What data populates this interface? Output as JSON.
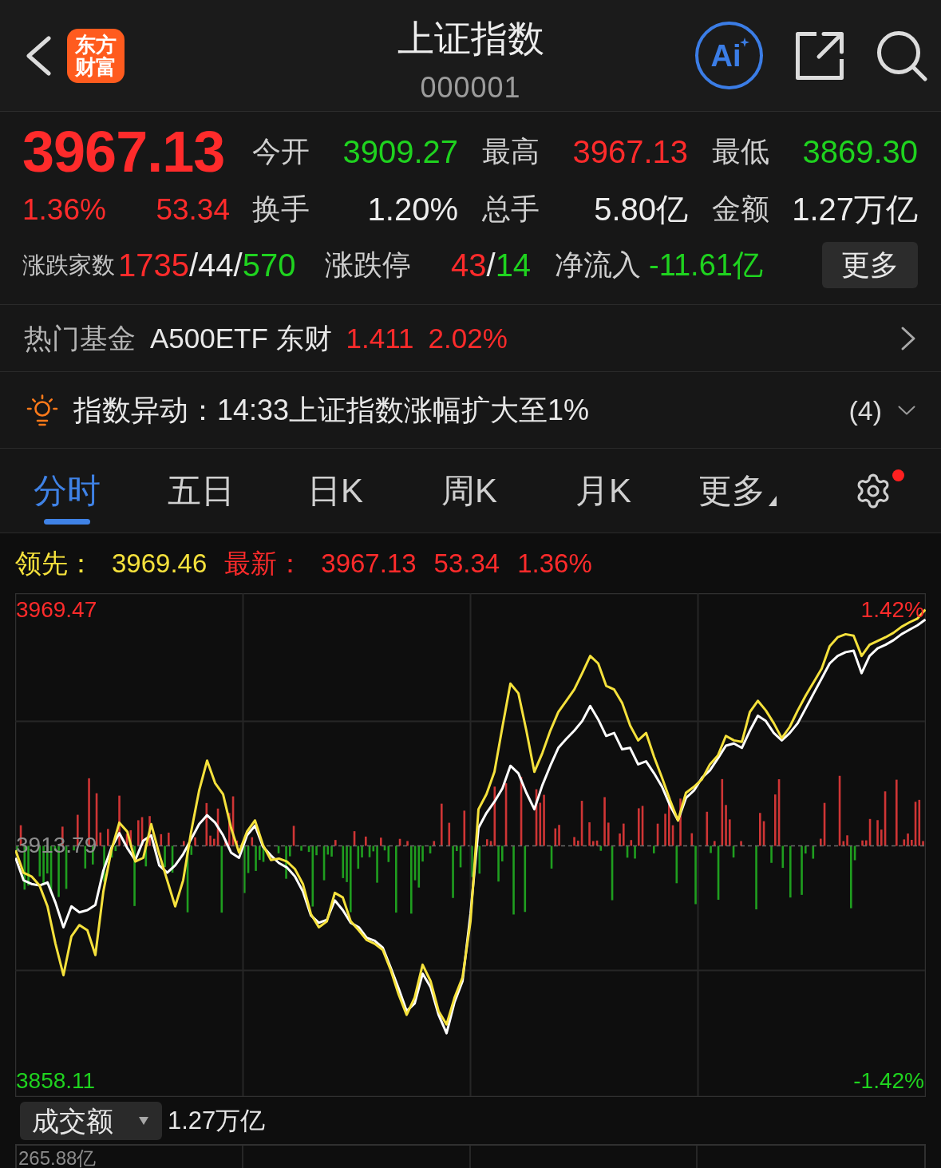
{
  "header": {
    "logo_lines": [
      "东方",
      "财富"
    ],
    "title": "上证指数",
    "code": "000001",
    "ai_label": "Ai"
  },
  "quote": {
    "price": "3967.13",
    "change_pct": "1.36%",
    "change": "53.34",
    "color": "#ff2b2b",
    "stat_rows": [
      [
        {
          "label": "今开",
          "value": "3909.27",
          "color": "#1fd31f"
        },
        {
          "label": "最高",
          "value": "3967.13",
          "color": "#ff2b2b"
        },
        {
          "label": "最低",
          "value": "3869.30",
          "color": "#1fd31f"
        }
      ],
      [
        {
          "label": "换手",
          "value": "1.20%",
          "color": "#ececec"
        },
        {
          "label": "总手",
          "value": "5.80亿",
          "color": "#ececec"
        },
        {
          "label": "金额",
          "value": "1.27万亿",
          "color": "#ececec"
        }
      ]
    ],
    "breadth": {
      "label": "涨跌家数",
      "parts": [
        {
          "text": "1735",
          "color": "#ff2b2b"
        },
        {
          "text": "/44/",
          "color": "#ececec"
        },
        {
          "text": "570",
          "color": "#1fd31f"
        }
      ]
    },
    "limits": {
      "label": "涨跌停",
      "parts": [
        {
          "text": "43",
          "color": "#ff2b2b"
        },
        {
          "text": "/",
          "color": "#ececec"
        },
        {
          "text": "14",
          "color": "#1fd31f"
        }
      ]
    },
    "net_inflow": {
      "label": "净流入",
      "value": "-11.61亿",
      "color": "#1fd31f"
    },
    "more_button": "更多"
  },
  "hot_fund": {
    "label": "热门基金",
    "name": "A500ETF 东财",
    "price": "1.411",
    "change_pct": "2.02%",
    "color": "#ff2b2b"
  },
  "alert": {
    "text": "指数异动：14:33上证指数涨幅扩大至1%",
    "count": "(4)"
  },
  "tabs": [
    {
      "label": "分时",
      "selected": true,
      "kind": "tab"
    },
    {
      "label": "五日",
      "selected": false,
      "kind": "tab"
    },
    {
      "label": "日K",
      "selected": false,
      "kind": "tab"
    },
    {
      "label": "周K",
      "selected": false,
      "kind": "tab"
    },
    {
      "label": "月K",
      "selected": false,
      "kind": "tab"
    },
    {
      "label": "更多",
      "selected": false,
      "kind": "menu"
    }
  ],
  "settings": {
    "notification": true
  },
  "chart_header": {
    "leading": {
      "label": "领先：",
      "value": "3969.46"
    },
    "latest": {
      "label": "最新：",
      "price": "3967.13",
      "change": "53.34",
      "change_pct": "1.36%",
      "color": "#ff2b2b"
    }
  },
  "chart": {
    "chart_data": {
      "type": "line",
      "ylim": [
        3854.34,
        3973.25
      ],
      "yticks": [
        {
          "value": 3969.47,
          "label": "3969.47"
        },
        {
          "value": 3913.79,
          "label": "3913.79"
        },
        {
          "value": 3858.11,
          "label": "3858.11"
        }
      ],
      "series": [
        {
          "color": "#ffffff",
          "values": [
            3910.78,
            3905.48,
            3904.6,
            3904.24,
            3904.95,
            3900.18,
            3894.35,
            3899.3,
            3897.88,
            3898.41,
            3899.65,
            3907.78,
            3913.08,
            3916.62,
            3913.08,
            3910.25,
            3914.85,
            3916.09,
            3909.02,
            3907.25,
            3909.02,
            3911.67,
            3915.2,
            3918.74,
            3920.86,
            3919.09,
            3916.09,
            3912.02,
            3910.78,
            3916.09,
            3918.39,
            3913.44,
            3911.32,
            3909.55,
            3908.49,
            3906.37,
            3902.83,
            3897.17,
            3895.41,
            3896.11,
            3900.71,
            3898.41,
            3895.41,
            3894.35,
            3891.87,
            3891.16,
            3889.57,
            3884.8,
            3879.85,
            3874.55,
            3876.32,
            3883.39,
            3880.21,
            3873.67,
            3869.3,
            3876.67,
            3881.62,
            3897.53,
            3917.86,
            3921.39,
            3924.04,
            3927.22,
            3932.53,
            3930.76,
            3926.16,
            3922.27,
            3927.93,
            3932.53,
            3936.77,
            3938.89,
            3940.83,
            3943.13,
            3946.67,
            3943.49,
            3939.6,
            3940.3,
            3936.42,
            3936.77,
            3932.88,
            3933.59,
            3930.76,
            3927.58,
            3923.16,
            3919.62,
            3924.93,
            3926.69,
            3929.7,
            3931.47,
            3934.29,
            3937.3,
            3937.83,
            3936.77,
            3940.83,
            3944.37,
            3943.13,
            3940.3,
            3938.54,
            3940.3,
            3942.6,
            3946.14,
            3949.67,
            3953.21,
            3956.74,
            3958.51,
            3959.39,
            3959.75,
            3954.44,
            3958.51,
            3960.28,
            3961.16,
            3962.22,
            3963.64,
            3964.7,
            3965.76,
            3967.13
          ]
        },
        {
          "color": "#f5e13c",
          "values": [
            3912.55,
            3907.25,
            3906.37,
            3904.24,
            3899.3,
            3890.46,
            3883.03,
            3892.23,
            3894.88,
            3893.64,
            3887.81,
            3902.83,
            3912.55,
            3919.09,
            3916.97,
            3909.9,
            3910.78,
            3918.74,
            3911.67,
            3905.48,
            3899.3,
            3905.48,
            3916.97,
            3926.69,
            3933.76,
            3928.46,
            3925.81,
            3917.86,
            3912.02,
            3916.97,
            3919.62,
            3913.79,
            3910.25,
            3910.61,
            3909.9,
            3908.13,
            3904.6,
            3897.53,
            3894.35,
            3895.76,
            3902.48,
            3901.42,
            3895.76,
            3893.64,
            3891.34,
            3890.46,
            3889.04,
            3884.27,
            3878.44,
            3873.67,
            3877.73,
            3885.51,
            3881.62,
            3874.55,
            3871.37,
            3877.73,
            3882.5,
            3895.76,
            3922.27,
            3925.81,
            3931.11,
            3941.72,
            3951.97,
            3949.67,
            3940.83,
            3931.11,
            3935.53,
            3940.83,
            3945.25,
            3947.9,
            3950.56,
            3954.44,
            3958.51,
            3956.74,
            3951.44,
            3950.56,
            3947.37,
            3942.07,
            3938.54,
            3940.3,
            3934.65,
            3929.7,
            3924.4,
            3919.62,
            3926.16,
            3927.58,
            3929.35,
            3932.88,
            3935.0,
            3939.6,
            3938.54,
            3938.18,
            3945.25,
            3947.9,
            3945.61,
            3942.6,
            3939.07,
            3941.72,
            3945.61,
            3949.14,
            3952.32,
            3955.51,
            3960.81,
            3962.93,
            3963.64,
            3963.28,
            3958.51,
            3961.16,
            3962.04,
            3962.93,
            3963.99,
            3965.4,
            3966.46,
            3967.35,
            3969.46
          ]
        }
      ]
    },
    "right_labels": [
      "1.42%",
      "-1.42%"
    ]
  },
  "volume": {
    "metric": "成交额",
    "total": "1.27万亿",
    "axis_label": "265.88亿"
  }
}
